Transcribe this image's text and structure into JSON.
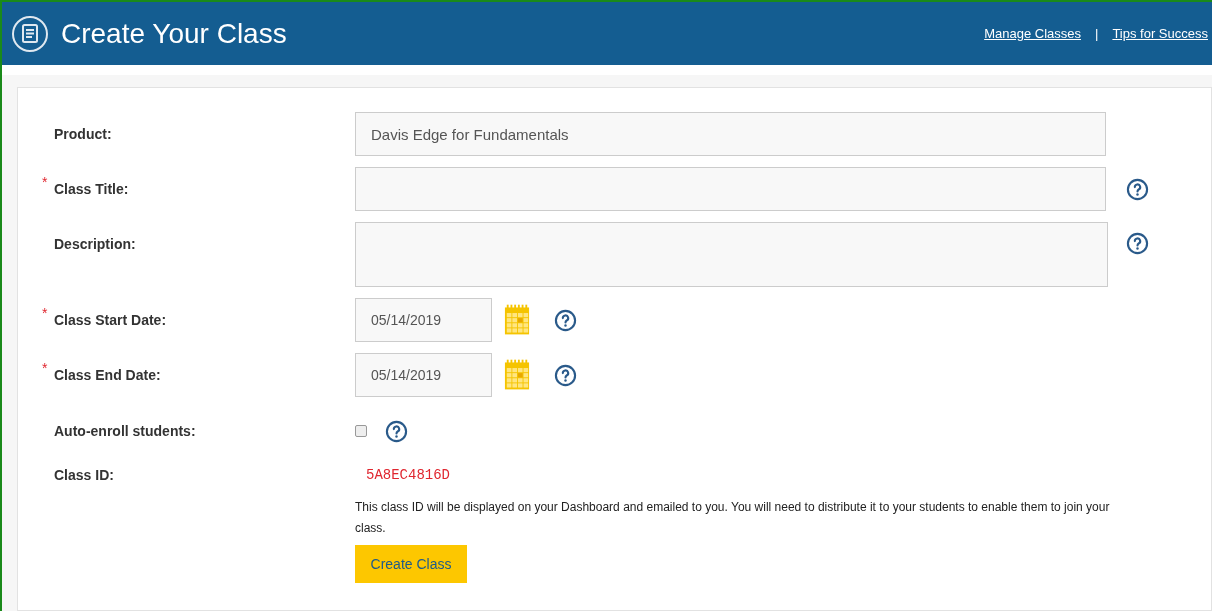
{
  "header": {
    "title": "Create Your Class",
    "links": [
      "Manage Classes",
      "Tips for Success"
    ],
    "separator": "|"
  },
  "fields": [
    {
      "kind": "text",
      "label": "Product:",
      "required": false,
      "help": false,
      "value": "Davis Edge for Fundamentals"
    },
    {
      "kind": "text",
      "label": "Class Title:",
      "required": true,
      "help": true
    },
    {
      "kind": "textarea",
      "label": "Description:",
      "required": false,
      "help": true
    },
    {
      "kind": "date",
      "label": "Class Start Date:",
      "required": true,
      "help": true,
      "value": "05/14/2019"
    },
    {
      "kind": "date",
      "label": "Class End Date:",
      "required": true,
      "help": true,
      "value": "05/14/2019"
    },
    {
      "kind": "checkbox",
      "label": "Auto-enroll students:",
      "required": false,
      "help": true,
      "checked": false
    },
    {
      "kind": "id",
      "label": "Class ID:",
      "required": false,
      "help": false,
      "value": "5A8EC4816D"
    }
  ],
  "note": "This class ID will be displayed on your Dashboard and emailed to you. You will need to distribute it to your students to enable them to join your class.",
  "submit": "Create Class",
  "required_mark": "*"
}
